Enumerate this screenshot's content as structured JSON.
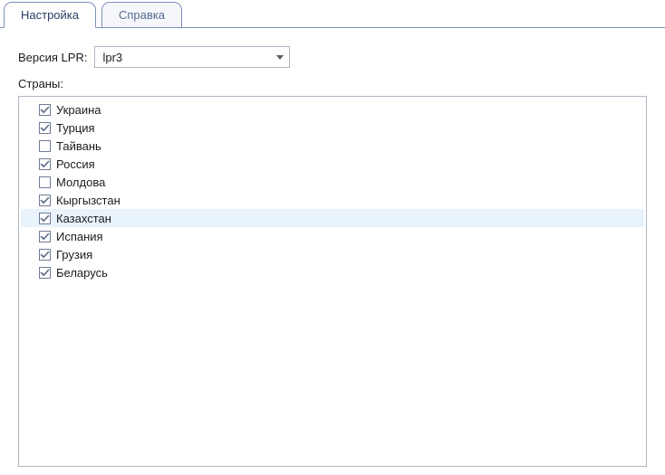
{
  "tabs": [
    {
      "label": "Настройка",
      "active": true
    },
    {
      "label": "Справка",
      "active": false
    }
  ],
  "form": {
    "version_label": "Версия LPR:",
    "version_value": "lpr3",
    "countries_label": "Страны:"
  },
  "countries": [
    {
      "label": "Украина",
      "checked": true,
      "highlight": false
    },
    {
      "label": "Турция",
      "checked": true,
      "highlight": false
    },
    {
      "label": "Тайвань",
      "checked": false,
      "highlight": false
    },
    {
      "label": "Россия",
      "checked": true,
      "highlight": false
    },
    {
      "label": "Молдова",
      "checked": false,
      "highlight": false
    },
    {
      "label": "Кыргызстан",
      "checked": true,
      "highlight": false
    },
    {
      "label": "Казахстан",
      "checked": true,
      "highlight": true
    },
    {
      "label": "Испания",
      "checked": true,
      "highlight": false
    },
    {
      "label": "Грузия",
      "checked": true,
      "highlight": false
    },
    {
      "label": "Беларусь",
      "checked": true,
      "highlight": false
    }
  ]
}
